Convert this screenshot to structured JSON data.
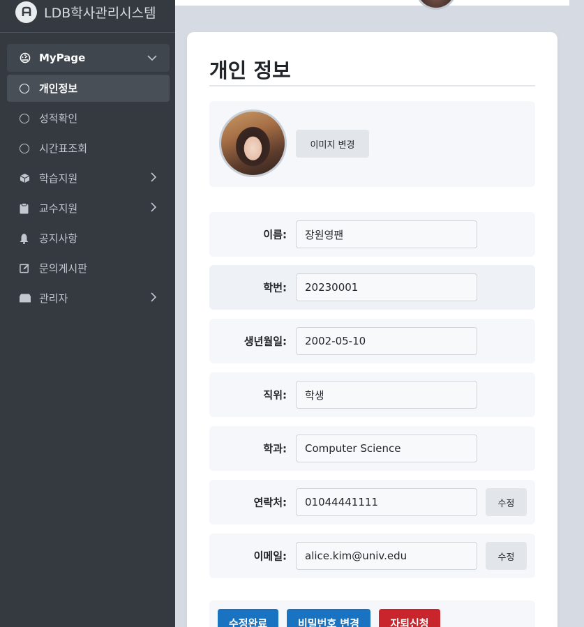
{
  "brand": {
    "title": "LDB학사관리시스템",
    "logo_icon": "app-logo-icon"
  },
  "sidebar": {
    "items": [
      {
        "label": "MyPage",
        "icon": "dashboard-icon",
        "chevron": "down"
      },
      {
        "label": "개인정보",
        "icon": "circle-icon"
      },
      {
        "label": "성적확인",
        "icon": "circle-icon"
      },
      {
        "label": "시간표조회",
        "icon": "circle-icon"
      },
      {
        "label": "학습지원",
        "icon": "box-icon",
        "chevron": "right"
      },
      {
        "label": "교수지원",
        "icon": "clipboard-icon",
        "chevron": "right"
      },
      {
        "label": "공지사항",
        "icon": "bell-icon"
      },
      {
        "label": "문의게시판",
        "icon": "edit-icon"
      },
      {
        "label": "관리자",
        "icon": "drawer-icon",
        "chevron": "right"
      }
    ]
  },
  "main": {
    "title": "개인 정보",
    "image_button": "이미지 변경",
    "fields": [
      {
        "label": "이름:",
        "value": "장원영팬"
      },
      {
        "label": "학번:",
        "value": "20230001"
      },
      {
        "label": "생년월일:",
        "value": "2002-05-10"
      },
      {
        "label": "직위:",
        "value": "학생"
      },
      {
        "label": "학과:",
        "value": "Computer Science"
      },
      {
        "label": "연락처:",
        "value": "01044441111",
        "edit": "수정"
      },
      {
        "label": "이메일:",
        "value": "alice.kim@univ.edu",
        "edit": "수정"
      }
    ],
    "actions": {
      "save": "수정완료",
      "password": "비밀번호 변경",
      "withdraw": "자퇴신청"
    }
  },
  "colors": {
    "sidebar_bg": "#343a40",
    "primary": "#1a73c1",
    "danger": "#c9252c",
    "page_bg": "#d6dbe3"
  }
}
